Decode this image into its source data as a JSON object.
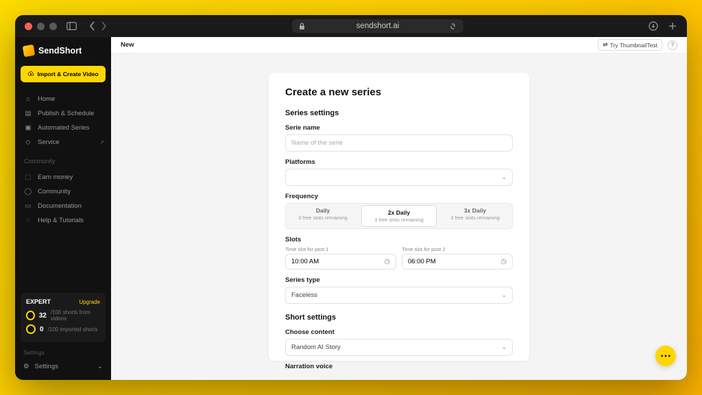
{
  "browser": {
    "url": "sendshort.ai"
  },
  "brand": {
    "name": "SendShort"
  },
  "sidebar": {
    "import_label": "Import & Create Video",
    "nav": [
      {
        "label": "Home"
      },
      {
        "label": "Publish & Schedule"
      },
      {
        "label": "Automated Series"
      },
      {
        "label": "Service"
      }
    ],
    "community_label": "Community",
    "community": [
      {
        "label": "Earn money"
      },
      {
        "label": "Community"
      },
      {
        "label": "Documentation"
      },
      {
        "label": "Help & Tutorials"
      }
    ],
    "expert": {
      "title": "EXPERT",
      "upgrade": "Upgrade",
      "stat1_num": "32",
      "stat1_text": "/100 shorts from videos",
      "stat2_num": "0",
      "stat2_text": "/100 imported shorts"
    },
    "settings_label": "Settings",
    "settings": "Settings"
  },
  "topbar": {
    "breadcrumb": "New",
    "try_label": "Try ThumbnailTest"
  },
  "form": {
    "title": "Create a new series",
    "settings_heading": "Series settings",
    "serie_name_label": "Serie name",
    "serie_name_placeholder": "Name of the serie",
    "platforms_label": "Platforms",
    "frequency_label": "Frequency",
    "freq_options": [
      {
        "title": "Daily",
        "sub": "3 free slots remaining"
      },
      {
        "title": "2x Daily",
        "sub": "3 free slots remaining"
      },
      {
        "title": "3x Daily",
        "sub": "3 free slots remaining"
      }
    ],
    "slots_label": "Slots",
    "slot1_label": "Time slot for post 1",
    "slot1_value": "10:00 AM",
    "slot2_label": "Time slot for post 2",
    "slot2_value": "06:00 PM",
    "series_type_label": "Series type",
    "series_type_value": "Faceless",
    "short_heading": "Short settings",
    "choose_content_label": "Choose content",
    "choose_content_value": "Random AI Story",
    "narration_label": "Narration voice"
  }
}
